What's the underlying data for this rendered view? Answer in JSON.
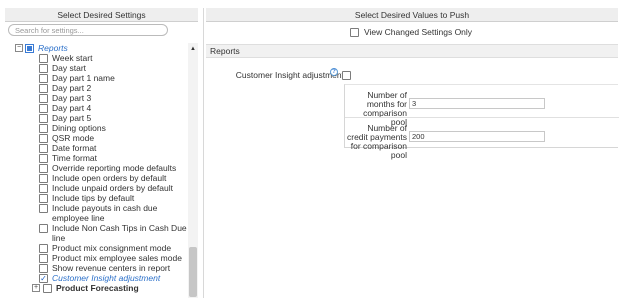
{
  "left": {
    "title": "Select Desired Settings",
    "search_placeholder": "Search for settings...",
    "tree": {
      "collapse_glyph": "−",
      "expand_glyph": "+",
      "parent_label": "Reports",
      "items": [
        {
          "label": "Week start",
          "checked": false
        },
        {
          "label": "Day start",
          "checked": false
        },
        {
          "label": "Day part 1 name",
          "checked": false
        },
        {
          "label": "Day part 2",
          "checked": false
        },
        {
          "label": "Day part 3",
          "checked": false
        },
        {
          "label": "Day part 4",
          "checked": false
        },
        {
          "label": "Day part 5",
          "checked": false
        },
        {
          "label": "Dining options",
          "checked": false
        },
        {
          "label": "QSR mode",
          "checked": false
        },
        {
          "label": "Date format",
          "checked": false
        },
        {
          "label": "Time format",
          "checked": false
        },
        {
          "label": "Override reporting mode defaults",
          "checked": false
        },
        {
          "label": "Include open orders by default",
          "checked": false
        },
        {
          "label": "Include unpaid orders by default",
          "checked": false
        },
        {
          "label": "Include tips by default",
          "checked": false
        },
        {
          "label": "Include payouts in cash due employee line",
          "checked": false
        },
        {
          "label": "Include Non Cash Tips in Cash Due line",
          "checked": false
        },
        {
          "label": "Product mix consignment mode",
          "checked": false
        },
        {
          "label": "Product mix employee sales mode",
          "checked": false
        },
        {
          "label": "Show revenue centers in report",
          "checked": false
        },
        {
          "label": "Customer Insight adjustment",
          "checked": true
        }
      ],
      "sibling_label": "Product Forecasting"
    },
    "scroll_up_glyph": "▲"
  },
  "right": {
    "title": "Select Desired Values to Push",
    "view_changed_label": "View Changed Settings Only",
    "section_title": "Reports",
    "setting": {
      "label": "Customer Insight adjustment",
      "info_glyph": "?",
      "fields": [
        {
          "label": "Number of months for comparison pool",
          "value": "3"
        },
        {
          "label": "Number of credit payments for comparison pool",
          "value": "200"
        }
      ]
    }
  },
  "colors": {
    "accent": "#2a6fc9",
    "header_bg": "#eeeeee",
    "border": "#cfcfcf"
  },
  "icons": {
    "collapse": "minus-box-icon",
    "expand": "plus-box-icon",
    "info": "info-icon",
    "scroll_up": "caret-up-icon",
    "check": "check-icon"
  }
}
